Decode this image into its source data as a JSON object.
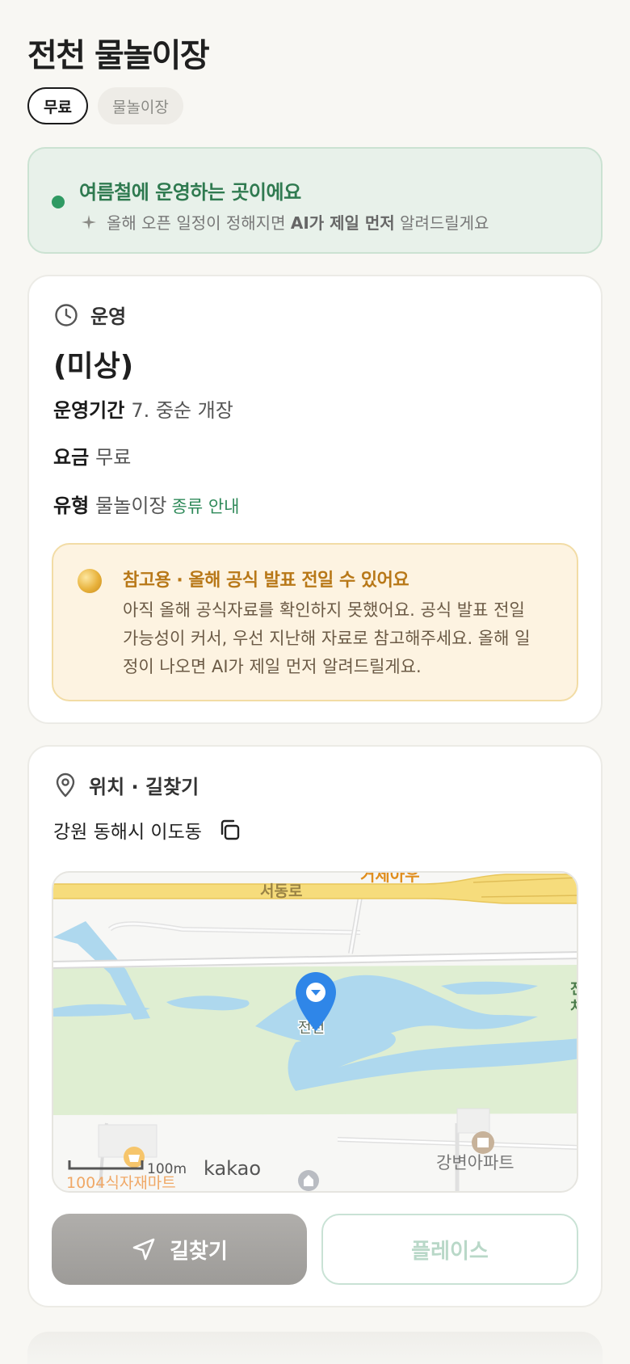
{
  "page": {
    "title": "전천 물놀이장"
  },
  "chips": [
    {
      "label": "무료",
      "active": true
    },
    {
      "label": "물놀이장",
      "active": false
    }
  ],
  "season": {
    "headline": "여름철에 운영하는 곳이에요",
    "sub_prefix": "올해 오픈 일정이 정해지면",
    "sub_bold": "AI가 제일 먼저",
    "sub_suffix": "알려드릴게요"
  },
  "operation": {
    "section_label": "운영",
    "status": "(미상)",
    "period_key": "운영기간",
    "period_value": "7. 중순 개장",
    "fee_key": "요금",
    "fee_value": "무료",
    "type_key": "유형",
    "type_value": "물놀이장",
    "type_link": "종류 안내"
  },
  "notice": {
    "headline": "참고용 · 올해 공식 발표 전일 수 있어요",
    "body": "아직 올해 공식자료를 확인하지 못했어요. 공식 발표 전일 가능성이 커서, 우선 지난해 자료로 참고해주세요. 올해 일정이 나오면 AI가 제일 먼저 알려드릴게요."
  },
  "location": {
    "section_label": "위치 · 길찾기",
    "address": "강원 동해시 이도동",
    "map": {
      "road_label": "서동로",
      "road_label_top": "거제아우",
      "pin_label": "전천",
      "right_edge_label": "전\n처",
      "apartment_label": "강변아파트",
      "mart_label": "1004식자재마트",
      "scale_label": "100m",
      "brand": "kakao"
    },
    "route_button": "길찾기",
    "place_button": "플레이스"
  },
  "colors": {
    "accent_green": "#2f9a63",
    "pin_blue": "#2f86e8",
    "water": "#aed8ee",
    "park": "#dfeed2",
    "road_yellow": "#f6dc7c"
  }
}
